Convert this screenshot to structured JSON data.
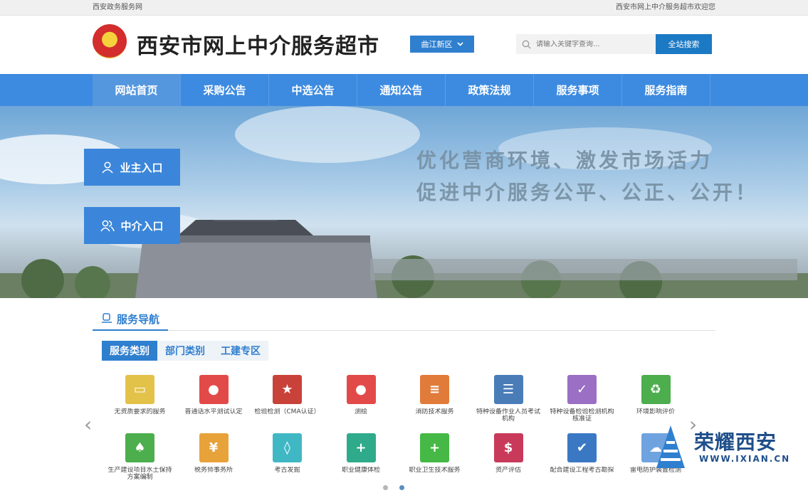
{
  "topbar": {
    "left": "西安政务服务网",
    "right": "西安市网上中介服务超市欢迎您"
  },
  "header": {
    "title": "西安市网上中介服务超市",
    "region": "曲江新区",
    "search_placeholder": "请输入关键字查询...",
    "search_button": "全站搜索"
  },
  "nav": [
    "网站首页",
    "采购公告",
    "中选公告",
    "通知公告",
    "政策法规",
    "服务事项",
    "服务指南"
  ],
  "banner": {
    "owner_entry": "业主入口",
    "agent_entry": "中介入口",
    "slogan_line1": "优化营商环境、激发市场活力",
    "slogan_line2": "促进中介服务公平、公正、公开！"
  },
  "service": {
    "title": "服务导航",
    "tabs": [
      "服务类别",
      "部门类别",
      "工建专区"
    ],
    "items": [
      {
        "label": "无资质要求的服务",
        "color": "#e3c24a",
        "icon": "certificate-icon"
      },
      {
        "label": "普通话水平测试认定",
        "color": "#e24a4a",
        "icon": "stamp-icon"
      },
      {
        "label": "检验检测（CMA认证）",
        "color": "#c9423a",
        "icon": "medal-icon"
      },
      {
        "label": "测绘",
        "color": "#e24a4a",
        "icon": "stamp-icon"
      },
      {
        "label": "消防技术服务",
        "color": "#e17b3a",
        "icon": "document-icon"
      },
      {
        "label": "特种设备作业人员考试机构",
        "color": "#4a7db8",
        "icon": "clipboard-icon"
      },
      {
        "label": "特种设备检验检测机构核准证",
        "color": "#9a6fc4",
        "icon": "document-check-icon"
      },
      {
        "label": "环境影响评价",
        "color": "#4cae4c",
        "icon": "recycle-icon"
      },
      {
        "label": "生产建设项目水土保持方案编制",
        "color": "#4cae4c",
        "icon": "tree-icon"
      },
      {
        "label": "税务师事务所",
        "color": "#e8a23a",
        "icon": "money-bag-icon"
      },
      {
        "label": "考古发掘",
        "color": "#3fb8c4",
        "icon": "vase-icon"
      },
      {
        "label": "职业健康体检",
        "color": "#2faa8a",
        "icon": "medical-kit-icon"
      },
      {
        "label": "职业卫生技术服务",
        "color": "#45b845",
        "icon": "first-aid-icon"
      },
      {
        "label": "资产评估",
        "color": "#c93a5a",
        "icon": "money-doc-icon"
      },
      {
        "label": "配合建设工程考古勘探",
        "color": "#3a78c4",
        "icon": "shield-icon"
      },
      {
        "label": "雷电防护装置检测",
        "color": "#6fa3e0",
        "icon": "cloud-icon"
      }
    ]
  },
  "watermark": {
    "text": "荣耀西安",
    "url": "WWW.IXIAN.CN"
  }
}
